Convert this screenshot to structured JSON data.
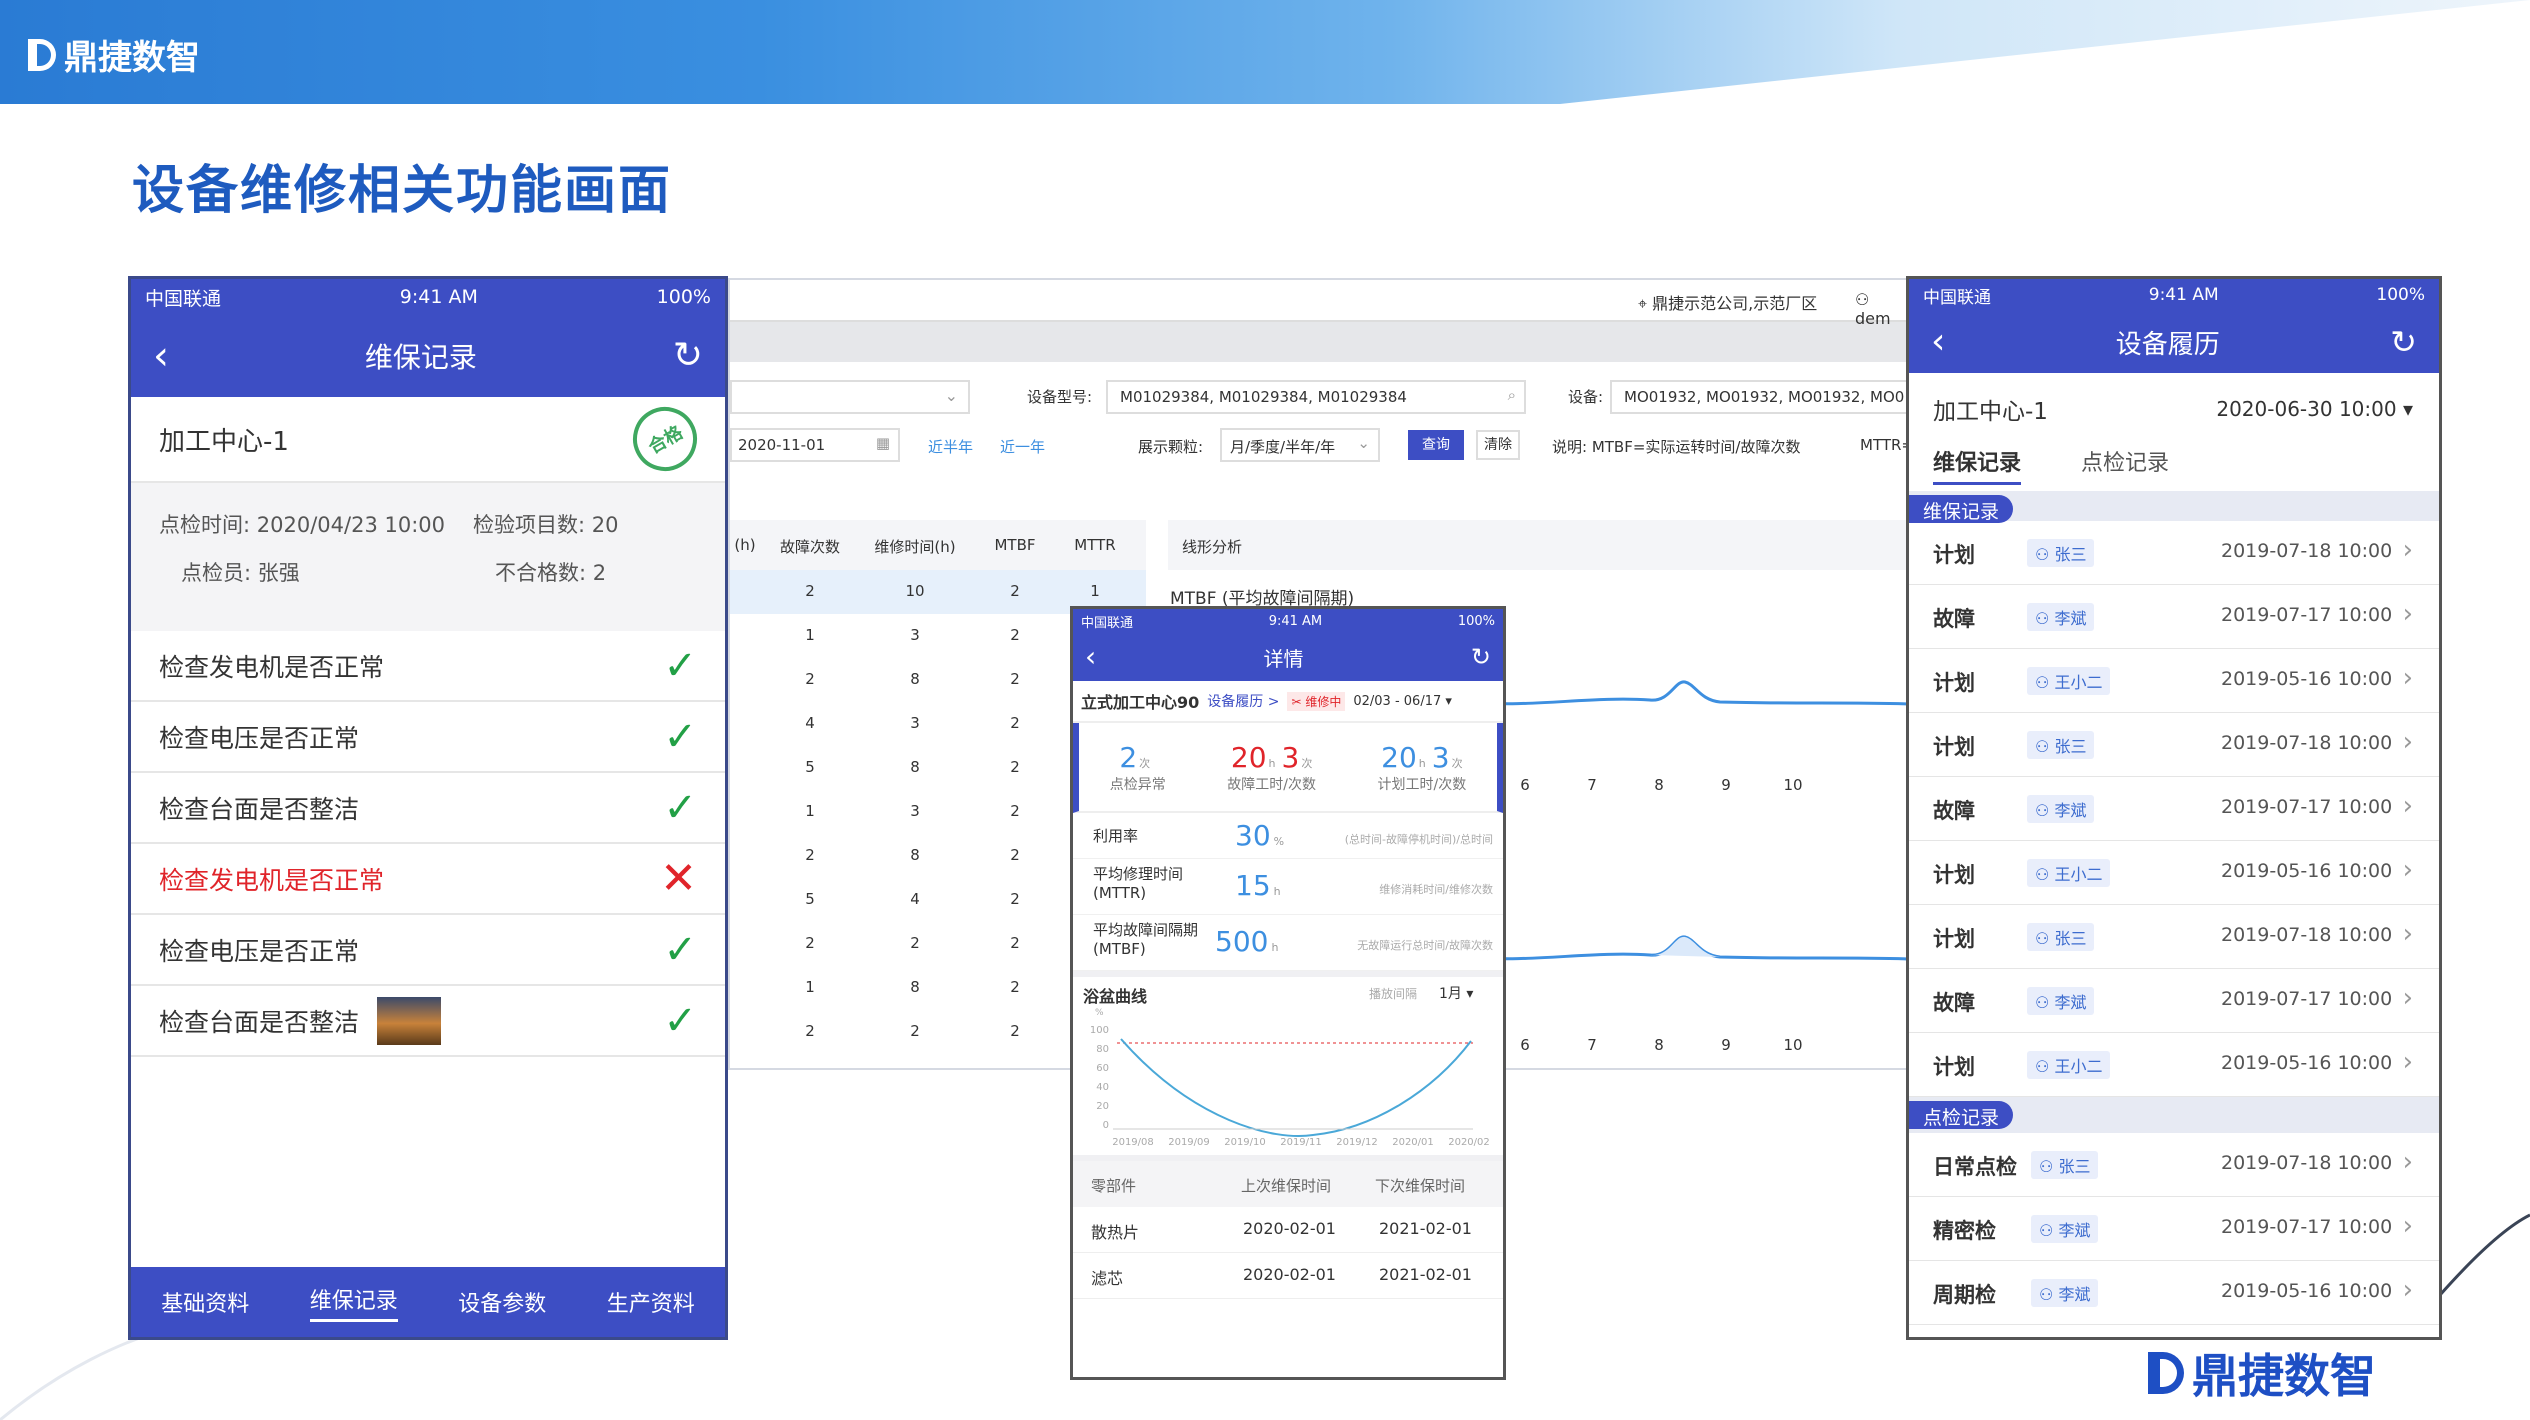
{
  "brand": {
    "name": "鼎捷数智"
  },
  "page_title": "设备维修相关功能画面",
  "phone_status": {
    "carrier": "中国联通",
    "time": "9:41 AM",
    "battery": "100%"
  },
  "p1": {
    "title": "维保记录",
    "device": "加工中心-1",
    "stamp": "合格",
    "info": {
      "time_label": "点检时间:",
      "time_value": "2020/04/23  10:00",
      "items_label": "检验项目数:",
      "items_value": "20",
      "inspector_label": "点检员:",
      "inspector_value": "张强",
      "fail_label": "不合格数:",
      "fail_value": "2"
    },
    "checks": [
      {
        "text": "检查发电机是否正常",
        "ok": true
      },
      {
        "text": "检查电压是否正常",
        "ok": true
      },
      {
        "text": "检查台面是否整洁",
        "ok": true
      },
      {
        "text": "检查发电机是否正常",
        "ok": false
      },
      {
        "text": "检查电压是否正常",
        "ok": true
      },
      {
        "text": "检查台面是否整洁",
        "ok": true,
        "photo": true
      }
    ],
    "tabs": [
      "基础资料",
      "维保记录",
      "设备参数",
      "生产资料"
    ],
    "active_tab": 1
  },
  "web": {
    "location": "鼎捷示范公司,示范厂区",
    "user": "dem",
    "filters": {
      "model_label": "设备型号:",
      "model_value": "M01029384, M01029384, M01029384",
      "device_label": "设备:",
      "device_value": "MO01932, MO01932, MO01932, MO0",
      "date_value": "2020-11-01",
      "half_year": "近半年",
      "one_year": "近一年",
      "granularity_label": "展示颗粒:",
      "granularity_value": "月/季度/半年/年",
      "query": "查询",
      "clear": "清除",
      "note": "说明: MTBF=实际运转时间/故障次数",
      "note2": "MTTR="
    },
    "table_headers": [
      "(h)",
      "故障次数",
      "维修时间(h)",
      "MTBF",
      "MTTR"
    ],
    "table_rows": [
      [
        "2",
        "10",
        "2",
        "1"
      ],
      [
        "1",
        "3",
        "2",
        ""
      ],
      [
        "2",
        "8",
        "2",
        ""
      ],
      [
        "4",
        "3",
        "2",
        ""
      ],
      [
        "5",
        "8",
        "2",
        ""
      ],
      [
        "1",
        "3",
        "2",
        ""
      ],
      [
        "2",
        "8",
        "2",
        ""
      ],
      [
        "5",
        "4",
        "2",
        ""
      ],
      [
        "2",
        "2",
        "2",
        ""
      ],
      [
        "1",
        "8",
        "2",
        ""
      ],
      [
        "2",
        "2",
        "2",
        ""
      ]
    ],
    "line_title": "线形分析",
    "mtbf_title": "MTBF (平均故障间隔期)",
    "x_ticks": [
      "6",
      "7",
      "8",
      "9",
      "10"
    ]
  },
  "p2": {
    "title": "详情",
    "device": "立式加工中心90",
    "history_link": "设备履历 >",
    "status_tag": "维修中",
    "date_range": "02/03 - 06/17",
    "stats": [
      {
        "n1": "2",
        "u1": "次",
        "label": "点检异常",
        "color": "#3d8fe0"
      },
      {
        "n1": "20",
        "u1": "h",
        "n2": "3",
        "u2": "次",
        "label": "故障工时/次数",
        "color": "#e0242a"
      },
      {
        "n1": "20",
        "u1": "h",
        "n2": "3",
        "u2": "次",
        "label": "计划工时/次数",
        "color": "#3d8fe0"
      }
    ],
    "metrics": [
      {
        "label": "利用率",
        "value": "30",
        "unit": "%",
        "note": "(总时间-故障停机时间)/总时间"
      },
      {
        "label": "平均修理时间\n(MTTR)",
        "value": "15",
        "unit": "h",
        "note": "维修消耗时间/维修次数"
      },
      {
        "label": "平均故障间隔期\n(MTBF)",
        "value": "500",
        "unit": "h",
        "note": "无故障运行总时间/故障次数"
      }
    ],
    "bathtub": {
      "title": "浴盆曲线",
      "interval_label": "播放间隔",
      "interval_value": "1月",
      "y_unit": "%",
      "y_ticks": [
        "100",
        "80",
        "60",
        "40",
        "20",
        "0"
      ],
      "x_ticks": [
        "2019/08",
        "2019/09",
        "2019/10",
        "2019/11",
        "2019/12",
        "2020/01",
        "2020/02"
      ]
    },
    "parts_headers": [
      "零部件",
      "上次维保时间",
      "下次维保时间"
    ],
    "parts": [
      [
        "散热片",
        "2020-02-01",
        "2021-02-01"
      ],
      [
        "滤芯",
        "2020-02-01",
        "2021-02-01"
      ]
    ]
  },
  "p3": {
    "title": "设备履历",
    "device": "加工中心-1",
    "datetime": "2020-06-30 10:00",
    "tabs": [
      "维保记录",
      "点检记录"
    ],
    "sec1": "维保记录",
    "maint": [
      [
        "计划",
        "张三",
        "2019-07-18 10:00"
      ],
      [
        "故障",
        "李斌",
        "2019-07-17 10:00"
      ],
      [
        "计划",
        "王小二",
        "2019-05-16 10:00"
      ],
      [
        "计划",
        "张三",
        "2019-07-18 10:00"
      ],
      [
        "故障",
        "李斌",
        "2019-07-17 10:00"
      ],
      [
        "计划",
        "王小二",
        "2019-05-16 10:00"
      ],
      [
        "计划",
        "张三",
        "2019-07-18 10:00"
      ],
      [
        "故障",
        "李斌",
        "2019-07-17 10:00"
      ],
      [
        "计划",
        "王小二",
        "2019-05-16 10:00"
      ]
    ],
    "sec2": "点检记录",
    "inspect": [
      [
        "日常点检",
        "张三",
        "2019-07-18 10:00"
      ],
      [
        "精密检",
        "李斌",
        "2019-07-17 10:00"
      ],
      [
        "周期检",
        "李斌",
        "2019-05-16 10:00"
      ]
    ]
  },
  "colors": {
    "primary": "#3d4ec4",
    "title_blue": "#1e5bbf",
    "ok": "#22a046",
    "bad": "#e0242a"
  }
}
